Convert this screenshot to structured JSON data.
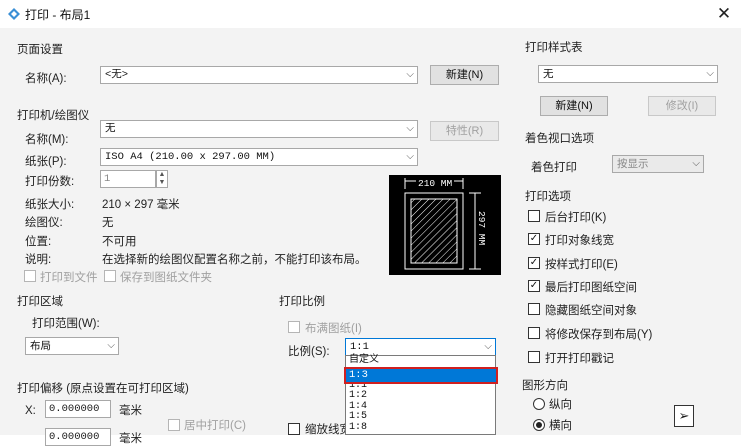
{
  "window": {
    "title": "打印 - 布局1",
    "close": "✕"
  },
  "page_setup": {
    "group_label": "页面设置",
    "name_label": "名称(A):",
    "name_value": "<无>",
    "new_btn": "新建(N)"
  },
  "printer": {
    "group_label": "打印机/绘图仪",
    "name_label": "名称(M):",
    "name_value": "无",
    "properties_btn": "特性(R)",
    "paper_label": "纸张(P):",
    "paper_value": "ISO A4 (210.00 x 297.00 MM)",
    "copies_label": "打印份数:",
    "copies_value": "1",
    "paper_size_label": "纸张大小:",
    "paper_size_value": "210 × 297  毫米",
    "plotter_label": "绘图仪:",
    "plotter_value": "无",
    "location_label": "位置:",
    "location_value": "不可用",
    "desc_label": "说明:",
    "desc_value": "在选择新的绘图仪配置名称之前，不能打印该布局。",
    "print_to_file": "打印到文件",
    "save_to_paper_file": "保存到图纸文件夹",
    "preview_width": "210 MM",
    "preview_height": "297 MM"
  },
  "plot_area": {
    "group_label": "打印区域",
    "range_label": "打印范围(W):",
    "range_value": "布局"
  },
  "plot_offset": {
    "group_label": "打印偏移 (原点设置在可打印区域)",
    "x_label": "X:",
    "x_value": "0.000000",
    "x_unit": "毫米",
    "center_label": "居中打印(C)",
    "y_value": "0.000000",
    "y_unit": "毫米"
  },
  "plot_scale": {
    "group_label": "打印比例",
    "fit_paper": "布满图纸(I)",
    "scale_label": "比例(S):",
    "scale_value": "1:1",
    "scale_lineweights": "缩放线宽",
    "options": [
      "自定义",
      "1:1",
      "1:2",
      "1:4",
      "1:5",
      "1:8"
    ],
    "selected_option": "1:3"
  },
  "plot_style": {
    "group_label": "打印样式表",
    "value": "无",
    "new_btn": "新建(N)",
    "edit_btn": "修改(I)"
  },
  "shaded_viewport": {
    "group_label": "着色视口选项",
    "shade_label": "着色打印",
    "shade_value": "按显示"
  },
  "plot_options": {
    "group_label": "打印选项",
    "items": [
      {
        "label": "后台打印(K)",
        "checked": false
      },
      {
        "label": "打印对象线宽",
        "checked": true
      },
      {
        "label": "按样式打印(E)",
        "checked": true
      },
      {
        "label": "最后打印图纸空间",
        "checked": true
      },
      {
        "label": "隐藏图纸空间对象",
        "checked": false
      },
      {
        "label": "将修改保存到布局(Y)",
        "checked": false
      },
      {
        "label": "打开打印戳记",
        "checked": false
      }
    ]
  },
  "orientation": {
    "group_label": "图形方向",
    "portrait": "纵向",
    "landscape": "横向",
    "selected": "landscape"
  },
  "colors": {
    "selection": "#0078d7",
    "highlight_border": "#d02020"
  }
}
